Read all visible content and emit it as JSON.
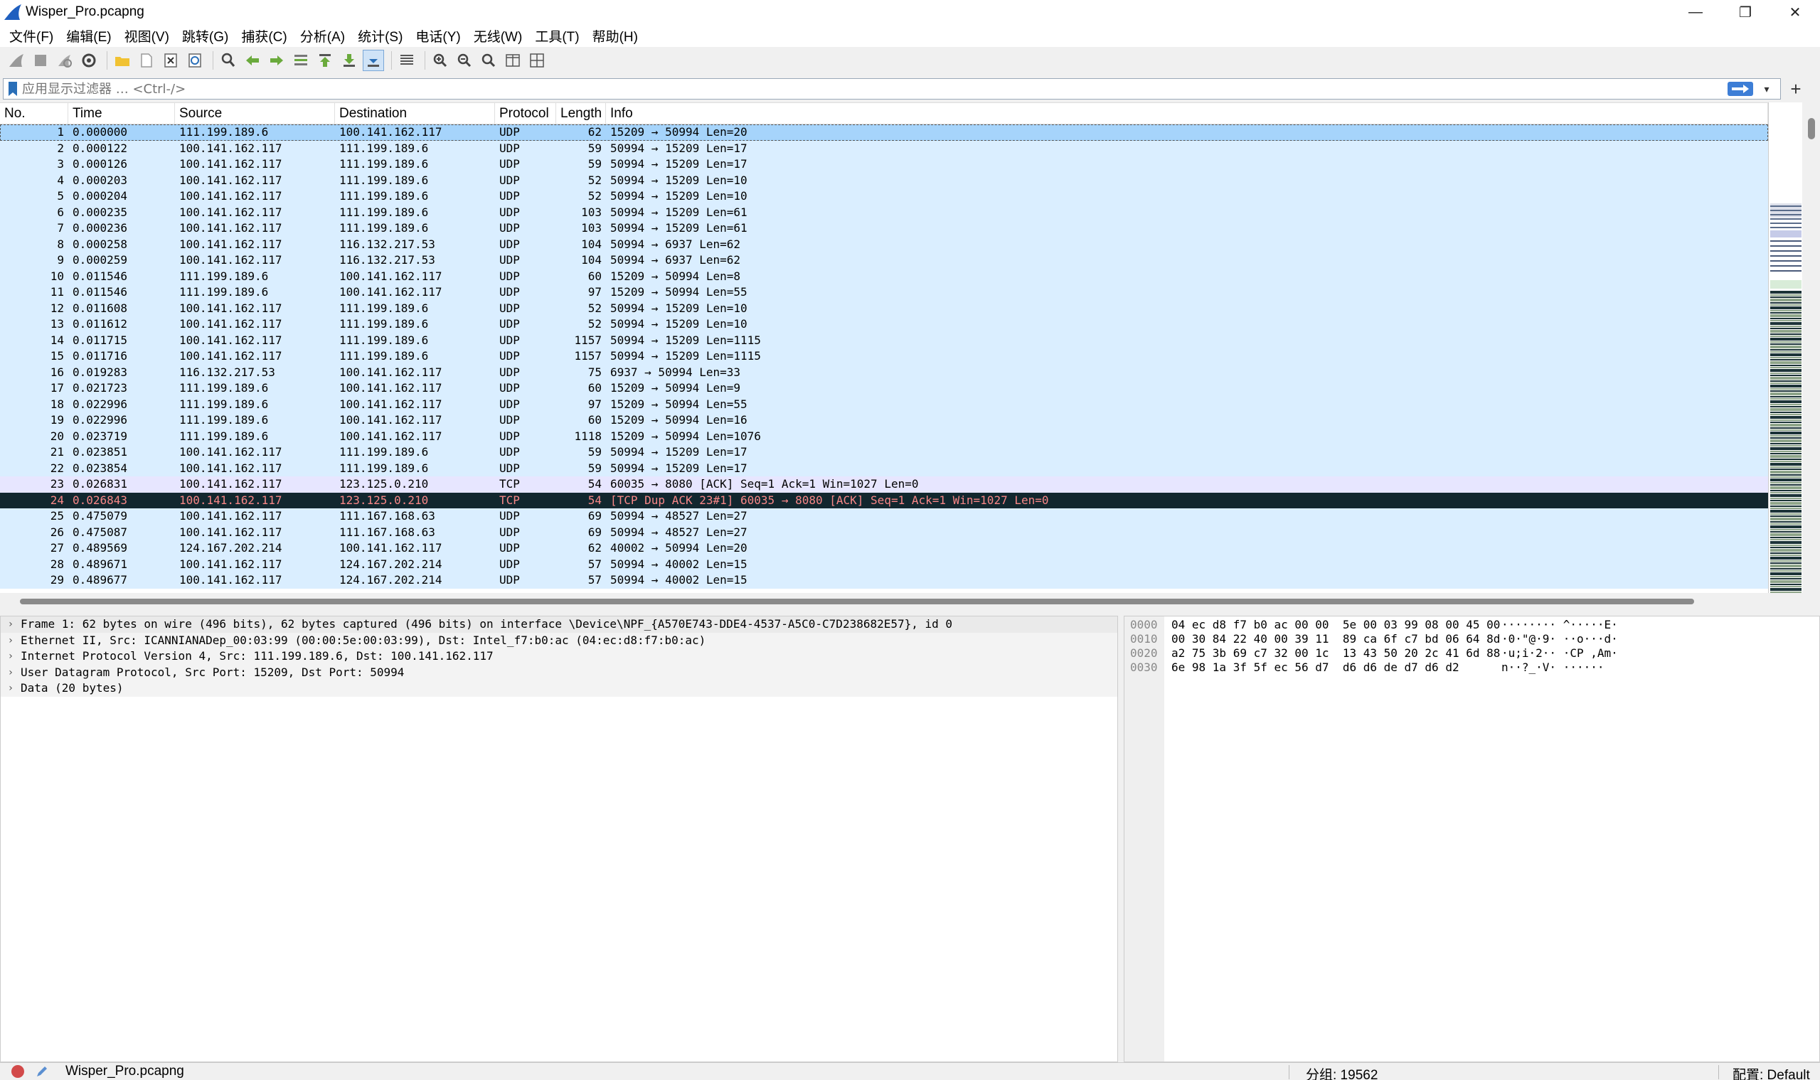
{
  "window": {
    "title": "Wisper_Pro.pcapng",
    "minimize": "—",
    "restore": "❐",
    "close": "✕"
  },
  "menu": [
    "文件(F)",
    "编辑(E)",
    "视图(V)",
    "跳转(G)",
    "捕获(C)",
    "分析(A)",
    "统计(S)",
    "电话(Y)",
    "无线(W)",
    "工具(T)",
    "帮助(H)"
  ],
  "toolbar": {
    "icons": [
      "shark-fin-start-icon",
      "stop-icon",
      "restart-icon",
      "capture-options-icon",
      "open-folder-icon",
      "save-icon",
      "close-file-icon",
      "reload-icon",
      "find-icon",
      "go-back-icon",
      "go-forward-icon",
      "go-to-packet-icon",
      "first-packet-icon",
      "last-packet-icon",
      "autoscroll-icon",
      "colorize-icon",
      "zoom-in-icon",
      "zoom-out-icon",
      "normal-size-icon",
      "resize-columns-icon",
      "layout-icon"
    ]
  },
  "filter": {
    "placeholder": "应用显示过滤器 … <Ctrl-/>",
    "plus": "+"
  },
  "packet_list": {
    "columns": [
      "No.",
      "Time",
      "Source",
      "Destination",
      "Protocol",
      "Length",
      "Info"
    ],
    "rows": [
      {
        "no": "1",
        "time": "0.000000",
        "src": "111.199.189.6",
        "dst": "100.141.162.117",
        "proto": "UDP",
        "len": "62",
        "info": "15209 → 50994 Len=20",
        "style": "sel"
      },
      {
        "no": "2",
        "time": "0.000122",
        "src": "100.141.162.117",
        "dst": "111.199.189.6",
        "proto": "UDP",
        "len": "59",
        "info": "50994 → 15209 Len=17",
        "style": "udp"
      },
      {
        "no": "3",
        "time": "0.000126",
        "src": "100.141.162.117",
        "dst": "111.199.189.6",
        "proto": "UDP",
        "len": "59",
        "info": "50994 → 15209 Len=17",
        "style": "udp"
      },
      {
        "no": "4",
        "time": "0.000203",
        "src": "100.141.162.117",
        "dst": "111.199.189.6",
        "proto": "UDP",
        "len": "52",
        "info": "50994 → 15209 Len=10",
        "style": "udp"
      },
      {
        "no": "5",
        "time": "0.000204",
        "src": "100.141.162.117",
        "dst": "111.199.189.6",
        "proto": "UDP",
        "len": "52",
        "info": "50994 → 15209 Len=10",
        "style": "udp"
      },
      {
        "no": "6",
        "time": "0.000235",
        "src": "100.141.162.117",
        "dst": "111.199.189.6",
        "proto": "UDP",
        "len": "103",
        "info": "50994 → 15209 Len=61",
        "style": "udp"
      },
      {
        "no": "7",
        "time": "0.000236",
        "src": "100.141.162.117",
        "dst": "111.199.189.6",
        "proto": "UDP",
        "len": "103",
        "info": "50994 → 15209 Len=61",
        "style": "udp"
      },
      {
        "no": "8",
        "time": "0.000258",
        "src": "100.141.162.117",
        "dst": "116.132.217.53",
        "proto": "UDP",
        "len": "104",
        "info": "50994 → 6937 Len=62",
        "style": "udp"
      },
      {
        "no": "9",
        "time": "0.000259",
        "src": "100.141.162.117",
        "dst": "116.132.217.53",
        "proto": "UDP",
        "len": "104",
        "info": "50994 → 6937 Len=62",
        "style": "udp"
      },
      {
        "no": "10",
        "time": "0.011546",
        "src": "111.199.189.6",
        "dst": "100.141.162.117",
        "proto": "UDP",
        "len": "60",
        "info": "15209 → 50994 Len=8",
        "style": "udp"
      },
      {
        "no": "11",
        "time": "0.011546",
        "src": "111.199.189.6",
        "dst": "100.141.162.117",
        "proto": "UDP",
        "len": "97",
        "info": "15209 → 50994 Len=55",
        "style": "udp"
      },
      {
        "no": "12",
        "time": "0.011608",
        "src": "100.141.162.117",
        "dst": "111.199.189.6",
        "proto": "UDP",
        "len": "52",
        "info": "50994 → 15209 Len=10",
        "style": "udp"
      },
      {
        "no": "13",
        "time": "0.011612",
        "src": "100.141.162.117",
        "dst": "111.199.189.6",
        "proto": "UDP",
        "len": "52",
        "info": "50994 → 15209 Len=10",
        "style": "udp"
      },
      {
        "no": "14",
        "time": "0.011715",
        "src": "100.141.162.117",
        "dst": "111.199.189.6",
        "proto": "UDP",
        "len": "1157",
        "info": "50994 → 15209 Len=1115",
        "style": "udp"
      },
      {
        "no": "15",
        "time": "0.011716",
        "src": "100.141.162.117",
        "dst": "111.199.189.6",
        "proto": "UDP",
        "len": "1157",
        "info": "50994 → 15209 Len=1115",
        "style": "udp"
      },
      {
        "no": "16",
        "time": "0.019283",
        "src": "116.132.217.53",
        "dst": "100.141.162.117",
        "proto": "UDP",
        "len": "75",
        "info": "6937 → 50994 Len=33",
        "style": "udp"
      },
      {
        "no": "17",
        "time": "0.021723",
        "src": "111.199.189.6",
        "dst": "100.141.162.117",
        "proto": "UDP",
        "len": "60",
        "info": "15209 → 50994 Len=9",
        "style": "udp"
      },
      {
        "no": "18",
        "time": "0.022996",
        "src": "111.199.189.6",
        "dst": "100.141.162.117",
        "proto": "UDP",
        "len": "97",
        "info": "15209 → 50994 Len=55",
        "style": "udp"
      },
      {
        "no": "19",
        "time": "0.022996",
        "src": "111.199.189.6",
        "dst": "100.141.162.117",
        "proto": "UDP",
        "len": "60",
        "info": "15209 → 50994 Len=16",
        "style": "udp"
      },
      {
        "no": "20",
        "time": "0.023719",
        "src": "111.199.189.6",
        "dst": "100.141.162.117",
        "proto": "UDP",
        "len": "1118",
        "info": "15209 → 50994 Len=1076",
        "style": "udp"
      },
      {
        "no": "21",
        "time": "0.023851",
        "src": "100.141.162.117",
        "dst": "111.199.189.6",
        "proto": "UDP",
        "len": "59",
        "info": "50994 → 15209 Len=17",
        "style": "udp"
      },
      {
        "no": "22",
        "time": "0.023854",
        "src": "100.141.162.117",
        "dst": "111.199.189.6",
        "proto": "UDP",
        "len": "59",
        "info": "50994 → 15209 Len=17",
        "style": "udp"
      },
      {
        "no": "23",
        "time": "0.026831",
        "src": "100.141.162.117",
        "dst": "123.125.0.210",
        "proto": "TCP",
        "len": "54",
        "info": "60035 → 8080 [ACK] Seq=1 Ack=1 Win=1027 Len=0",
        "style": "tcp"
      },
      {
        "no": "24",
        "time": "0.026843",
        "src": "100.141.162.117",
        "dst": "123.125.0.210",
        "proto": "TCP",
        "len": "54",
        "info": "[TCP Dup ACK 23#1] 60035 → 8080 [ACK] Seq=1 Ack=1 Win=1027 Len=0",
        "style": "bad"
      },
      {
        "no": "25",
        "time": "0.475079",
        "src": "100.141.162.117",
        "dst": "111.167.168.63",
        "proto": "UDP",
        "len": "69",
        "info": "50994 → 48527 Len=27",
        "style": "udp"
      },
      {
        "no": "26",
        "time": "0.475087",
        "src": "100.141.162.117",
        "dst": "111.167.168.63",
        "proto": "UDP",
        "len": "69",
        "info": "50994 → 48527 Len=27",
        "style": "udp"
      },
      {
        "no": "27",
        "time": "0.489569",
        "src": "124.167.202.214",
        "dst": "100.141.162.117",
        "proto": "UDP",
        "len": "62",
        "info": "40002 → 50994 Len=20",
        "style": "udp"
      },
      {
        "no": "28",
        "time": "0.489671",
        "src": "100.141.162.117",
        "dst": "124.167.202.214",
        "proto": "UDP",
        "len": "57",
        "info": "50994 → 40002 Len=15",
        "style": "udp"
      },
      {
        "no": "29",
        "time": "0.489677",
        "src": "100.141.162.117",
        "dst": "124.167.202.214",
        "proto": "UDP",
        "len": "57",
        "info": "50994 → 40002 Len=15",
        "style": "udp"
      }
    ]
  },
  "details": [
    "Frame 1: 62 bytes on wire (496 bits), 62 bytes captured (496 bits) on interface \\Device\\NPF_{A570E743-DDE4-4537-A5C0-C7D238682E57}, id 0",
    "Ethernet II, Src: ICANNIANADep_00:03:99 (00:00:5e:00:03:99), Dst: Intel_f7:b0:ac (04:ec:d8:f7:b0:ac)",
    "Internet Protocol Version 4, Src: 111.199.189.6, Dst: 100.141.162.117",
    "User Datagram Protocol, Src Port: 15209, Dst Port: 50994",
    "Data (20 bytes)"
  ],
  "bytes": [
    {
      "offset": "0000",
      "hex": "04 ec d8 f7 b0 ac 00 00  5e 00 03 99 08 00 45 00",
      "ascii": "········ ^·····E·"
    },
    {
      "offset": "0010",
      "hex": "00 30 84 22 40 00 39 11  89 ca 6f c7 bd 06 64 8d",
      "ascii": "·0·\"@·9· ··o···d·"
    },
    {
      "offset": "0020",
      "hex": "a2 75 3b 69 c7 32 00 1c  13 43 50 20 2c 41 6d 88",
      "ascii": "·u;i·2·· ·CP ,Am·"
    },
    {
      "offset": "0030",
      "hex": "6e 98 1a 3f 5f ec 56 d7  d6 d6 de d7 d6 d2",
      "ascii": "n··?_·V· ······"
    }
  ],
  "status": {
    "file": "Wisper_Pro.pcapng",
    "packets": "分组: 19562",
    "profile": "配置: Default"
  }
}
